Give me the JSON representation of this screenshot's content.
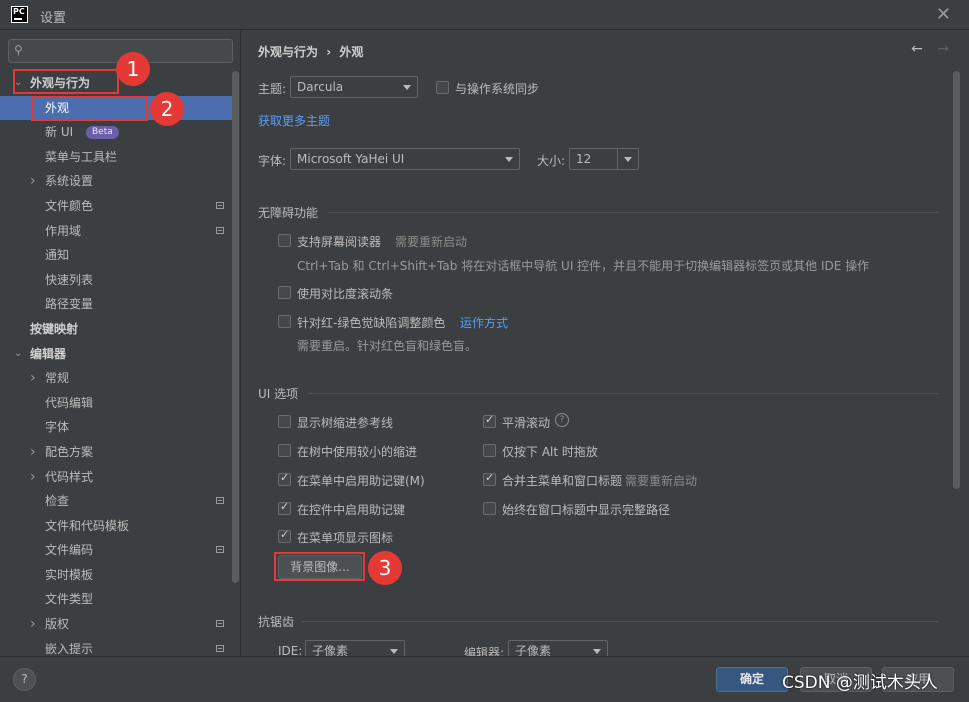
{
  "window": {
    "title": "设置",
    "logo_text": "PC"
  },
  "sidebar": {
    "search_placeholder": "",
    "items": [
      {
        "label": "外观与行为",
        "level": 0,
        "arrow": "expanded",
        "bold": true
      },
      {
        "label": "外观",
        "level": 1,
        "selected": true
      },
      {
        "label": "新 UI",
        "level": 1,
        "badge": "Beta"
      },
      {
        "label": "菜单与工具栏",
        "level": 1
      },
      {
        "label": "系统设置",
        "level": 1,
        "arrow": "collapsed"
      },
      {
        "label": "文件颜色",
        "level": 1,
        "page_icon": true
      },
      {
        "label": "作用域",
        "level": 1,
        "page_icon": true
      },
      {
        "label": "通知",
        "level": 1
      },
      {
        "label": "快速列表",
        "level": 1
      },
      {
        "label": "路径变量",
        "level": 1
      },
      {
        "label": "按键映射",
        "level": 0,
        "bold": true
      },
      {
        "label": "编辑器",
        "level": 0,
        "arrow": "expanded",
        "bold": true
      },
      {
        "label": "常规",
        "level": 1,
        "arrow": "collapsed"
      },
      {
        "label": "代码编辑",
        "level": 1
      },
      {
        "label": "字体",
        "level": 1
      },
      {
        "label": "配色方案",
        "level": 1,
        "arrow": "collapsed"
      },
      {
        "label": "代码样式",
        "level": 1,
        "arrow": "collapsed"
      },
      {
        "label": "检查",
        "level": 1,
        "page_icon": true
      },
      {
        "label": "文件和代码模板",
        "level": 1
      },
      {
        "label": "文件编码",
        "level": 1,
        "page_icon": true
      },
      {
        "label": "实时模板",
        "level": 1
      },
      {
        "label": "文件类型",
        "level": 1
      },
      {
        "label": "版权",
        "level": 1,
        "arrow": "collapsed",
        "page_icon": true
      },
      {
        "label": "嵌入提示",
        "level": 1,
        "page_icon": true
      }
    ]
  },
  "breadcrumb": {
    "parent": "外观与行为",
    "separator": "›",
    "current": "外观"
  },
  "theme": {
    "label": "主题:",
    "value": "Darcula",
    "sync_label": "与操作系统同步",
    "sync_checked": false,
    "more_link": "获取更多主题"
  },
  "font": {
    "label": "字体:",
    "value": "Microsoft YaHei UI",
    "size_label": "大小:",
    "size_value": "12"
  },
  "accessibility": {
    "title": "无障碍功能",
    "screen_reader": {
      "label": "支持屏幕阅读器",
      "checked": false,
      "hint": "需要重新启动",
      "desc": "Ctrl+Tab 和 Ctrl+Shift+Tab 将在对话框中导航 UI 控件，并且不能用于切换编辑器标签页或其他 IDE 操作"
    },
    "contrast_scroll": {
      "label": "使用对比度滚动条",
      "checked": false
    },
    "color_blind": {
      "label": "针对红-绿色觉缺陷调整颜色",
      "checked": false,
      "link": "运作方式",
      "desc": "需要重启。针对红色盲和绿色盲。"
    }
  },
  "ui_options": {
    "title": "UI 选项",
    "left": [
      {
        "label": "显示树缩进参考线",
        "checked": false
      },
      {
        "label": "在树中使用较小的缩进",
        "checked": false
      },
      {
        "label": "在菜单中启用助记键(M)",
        "checked": true
      },
      {
        "label": "在控件中启用助记键",
        "checked": true
      },
      {
        "label": "在菜单项显示图标",
        "checked": true
      }
    ],
    "right": [
      {
        "label": "平滑滚动",
        "checked": true,
        "help": "?"
      },
      {
        "label": "仅按下 Alt 时拖放",
        "checked": false
      },
      {
        "label": "合并主菜单和窗口标题",
        "checked": true,
        "hint": "需要重新启动"
      },
      {
        "label": "始终在窗口标题中显示完整路径",
        "checked": false
      }
    ],
    "bg_button": "背景图像..."
  },
  "antialiasing": {
    "title": "抗锯齿",
    "ide_label": "IDE:",
    "ide_value": "子像素",
    "editor_label": "编辑器:",
    "editor_value": "子像素"
  },
  "annotations": [
    "1",
    "2",
    "3"
  ],
  "footer": {
    "help": "?",
    "ok": "确定",
    "cancel": "取消",
    "apply": "应用"
  },
  "watermark": "CSDN @测试木头人",
  "colors": {
    "selection": "#4b6eaf",
    "link": "#589df6",
    "annotation": "#e53935",
    "badge": "#6b5fa8"
  }
}
